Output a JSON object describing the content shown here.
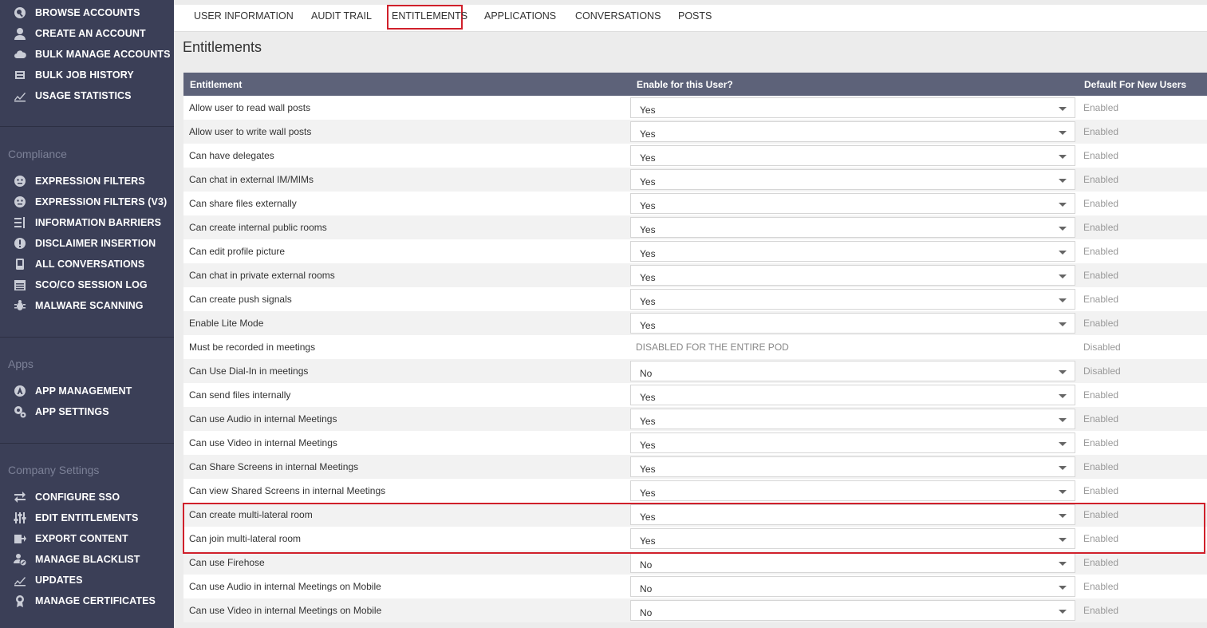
{
  "sidebar": {
    "top_items": [
      {
        "label": "BROWSE ACCOUNTS",
        "icon": "search-user-icon"
      },
      {
        "label": "CREATE AN ACCOUNT",
        "icon": "user-icon"
      },
      {
        "label": "BULK MANAGE ACCOUNTS",
        "icon": "cloud-icon"
      },
      {
        "label": "BULK JOB HISTORY",
        "icon": "inbox-icon"
      },
      {
        "label": "USAGE STATISTICS",
        "icon": "chart-icon"
      }
    ],
    "compliance": {
      "title": "Compliance",
      "items": [
        {
          "label": "EXPRESSION FILTERS",
          "icon": "filter-face-icon"
        },
        {
          "label": "EXPRESSION FILTERS (V3)",
          "icon": "filter-face-icon"
        },
        {
          "label": "INFORMATION BARRIERS",
          "icon": "barrier-icon"
        },
        {
          "label": "DISCLAIMER INSERTION",
          "icon": "alert-icon"
        },
        {
          "label": "ALL CONVERSATIONS",
          "icon": "phone-icon"
        },
        {
          "label": "SCO/CO SESSION LOG",
          "icon": "calendar-icon"
        },
        {
          "label": "MALWARE SCANNING",
          "icon": "bug-icon"
        }
      ]
    },
    "apps": {
      "title": "Apps",
      "items": [
        {
          "label": "APP MANAGEMENT",
          "icon": "app-icon"
        },
        {
          "label": "APP SETTINGS",
          "icon": "gears-icon"
        }
      ]
    },
    "company": {
      "title": "Company Settings",
      "items": [
        {
          "label": "CONFIGURE SSO",
          "icon": "arrows-icon"
        },
        {
          "label": "EDIT ENTITLEMENTS",
          "icon": "sliders-icon"
        },
        {
          "label": "EXPORT CONTENT",
          "icon": "export-icon"
        },
        {
          "label": "MANAGE BLACKLIST",
          "icon": "user-block-icon"
        },
        {
          "label": "UPDATES",
          "icon": "chart-icon"
        },
        {
          "label": "MANAGE CERTIFICATES",
          "icon": "certificate-icon"
        }
      ]
    }
  },
  "tabs": [
    {
      "label": "USER INFORMATION"
    },
    {
      "label": "AUDIT TRAIL"
    },
    {
      "label": "ENTITLEMENTS",
      "active": true
    },
    {
      "label": "APPLICATIONS"
    },
    {
      "label": "CONVERSATIONS"
    },
    {
      "label": "POSTS"
    }
  ],
  "page_title": "Entitlements",
  "table": {
    "headers": {
      "entitlement": "Entitlement",
      "enable": "Enable for this User?",
      "default": "Default For New Users"
    },
    "rows": [
      {
        "name": "Allow user to read wall posts",
        "value": "Yes",
        "default": "Enabled"
      },
      {
        "name": "Allow user to write wall posts",
        "value": "Yes",
        "default": "Enabled"
      },
      {
        "name": "Can have delegates",
        "value": "Yes",
        "default": "Enabled"
      },
      {
        "name": "Can chat in external IM/MIMs",
        "value": "Yes",
        "default": "Enabled"
      },
      {
        "name": "Can share files externally",
        "value": "Yes",
        "default": "Enabled"
      },
      {
        "name": "Can create internal public rooms",
        "value": "Yes",
        "default": "Enabled"
      },
      {
        "name": "Can edit profile picture",
        "value": "Yes",
        "default": "Enabled"
      },
      {
        "name": "Can chat in private external rooms",
        "value": "Yes",
        "default": "Enabled"
      },
      {
        "name": "Can create push signals",
        "value": "Yes",
        "default": "Enabled"
      },
      {
        "name": "Enable Lite Mode",
        "value": "Yes",
        "default": "Enabled"
      },
      {
        "name": "Must be recorded in meetings",
        "value": "DISABLED FOR THE ENTIRE POD",
        "disabled": true,
        "default": "Disabled"
      },
      {
        "name": "Can Use Dial-In in meetings",
        "value": "No",
        "default": "Disabled"
      },
      {
        "name": "Can send files internally",
        "value": "Yes",
        "default": "Enabled"
      },
      {
        "name": "Can use Audio in internal Meetings",
        "value": "Yes",
        "default": "Enabled"
      },
      {
        "name": "Can use Video in internal Meetings",
        "value": "Yes",
        "default": "Enabled"
      },
      {
        "name": "Can Share Screens in internal Meetings",
        "value": "Yes",
        "default": "Enabled"
      },
      {
        "name": "Can view Shared Screens in internal Meetings",
        "value": "Yes",
        "default": "Enabled"
      },
      {
        "name": "Can create multi-lateral room",
        "value": "Yes",
        "default": "Enabled"
      },
      {
        "name": "Can join multi-lateral room",
        "value": "Yes",
        "default": "Enabled"
      },
      {
        "name": "Can use Firehose",
        "value": "No",
        "default": "Enabled"
      },
      {
        "name": "Can use Audio in internal Meetings on Mobile",
        "value": "No",
        "default": "Enabled"
      },
      {
        "name": "Can use Video in internal Meetings on Mobile",
        "value": "No",
        "default": "Enabled"
      }
    ]
  },
  "colors": {
    "sidebar_bg": "#3b3f57",
    "table_header_bg": "#5d6279",
    "highlight": "#d0202b"
  }
}
